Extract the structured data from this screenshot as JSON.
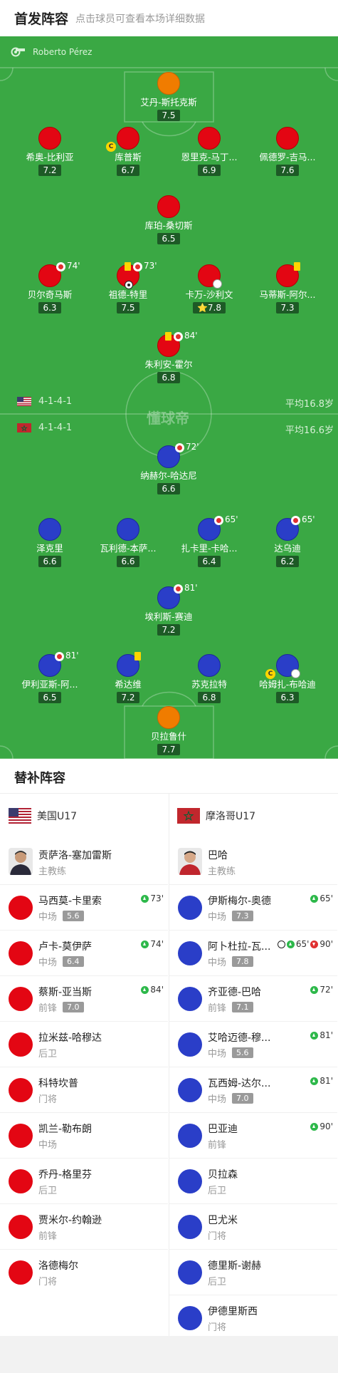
{
  "header": {
    "title": "首发阵容",
    "subtitle": "点击球员可查看本场详细数据"
  },
  "referee": {
    "icon": "whistle-icon",
    "name": "Roberto Pérez"
  },
  "home_lineup": {
    "formation": "4-1-4-1",
    "average_age": "平均16.8岁",
    "flag": "usa-flag-icon",
    "players": [
      {
        "name": "艾丹-斯托克斯",
        "rating": "7.5"
      },
      {
        "name": "希奥-比利亚",
        "rating": "7.2"
      },
      {
        "name": "库普斯",
        "rating": "6.7",
        "captain": "C"
      },
      {
        "name": "恩里克-马丁...",
        "rating": "6.9"
      },
      {
        "name": "佩德罗-吉马...",
        "rating": "7.6"
      },
      {
        "name": "库珀-桑切斯",
        "rating": "6.5"
      },
      {
        "name": "贝尔奇马斯",
        "rating": "6.3",
        "sub_off": "74'"
      },
      {
        "name": "祖德-特里",
        "rating": "7.5",
        "sub_off": "73'"
      },
      {
        "name": "卡万-沙利文",
        "rating": "7.8",
        "star": "⭐"
      },
      {
        "name": "马蒂斯-阿尔...",
        "rating": "7.3"
      },
      {
        "name": "朱利安-霍尔",
        "rating": "6.8",
        "sub_off": "84'"
      }
    ]
  },
  "away_lineup": {
    "formation": "4-1-4-1",
    "average_age": "平均16.6岁",
    "flag": "morocco-flag-icon",
    "players": [
      {
        "name": "纳赫尔-哈达尼",
        "rating": "6.6",
        "sub_off": "72'"
      },
      {
        "name": "泽克里",
        "rating": "6.6"
      },
      {
        "name": "瓦利德-本萨...",
        "rating": "6.6"
      },
      {
        "name": "扎卡里-卡哈...",
        "rating": "6.4",
        "sub_off": "65'"
      },
      {
        "name": "达乌迪",
        "rating": "6.2",
        "sub_off": "65'"
      },
      {
        "name": "埃利斯-赛迪",
        "rating": "7.2",
        "sub_off": "81'"
      },
      {
        "name": "伊利亚斯-阿...",
        "rating": "6.5",
        "sub_off": "81'"
      },
      {
        "name": "希达维",
        "rating": "7.2"
      },
      {
        "name": "苏克拉特",
        "rating": "6.8"
      },
      {
        "name": "哈姆扎-布哈迪",
        "rating": "6.3",
        "captain": "C"
      },
      {
        "name": "贝拉鲁什",
        "rating": "7.7"
      }
    ]
  },
  "pitch_logo": "懂球帝",
  "subs": {
    "title": "替补阵容",
    "home": {
      "team": "美国U17",
      "coach": {
        "name": "贡萨洛-塞加雷斯",
        "role": "主教练"
      },
      "players": [
        {
          "name": "马西莫-卡里索",
          "pos": "中场",
          "rating": "5.6",
          "event": "73'"
        },
        {
          "name": "卢卡-莫伊萨",
          "pos": "中场",
          "rating": "6.4",
          "event": "74'"
        },
        {
          "name": "蔡斯-亚当斯",
          "pos": "前锋",
          "rating": "7.0",
          "event": "84'"
        },
        {
          "name": "拉米兹-哈穆达",
          "pos": "后卫"
        },
        {
          "name": "科特坎普",
          "pos": "门将"
        },
        {
          "name": "凯兰-勒布朗",
          "pos": "中场"
        },
        {
          "name": "乔丹-格里芬",
          "pos": "后卫"
        },
        {
          "name": "贾米尔-约翰逊",
          "pos": "前锋"
        },
        {
          "name": "洛德梅尔",
          "pos": "门将"
        }
      ]
    },
    "away": {
      "team": "摩洛哥U17",
      "coach": {
        "name": "巴哈",
        "role": "主教练"
      },
      "players": [
        {
          "name": "伊斯梅尔-奥德",
          "pos": "中场",
          "rating": "7.3",
          "event": "65'"
        },
        {
          "name": "阿卜杜拉-瓦...",
          "pos": "中场",
          "rating": "7.8",
          "event": "65'",
          "event2": "90'"
        },
        {
          "name": "齐亚德-巴哈",
          "pos": "前锋",
          "rating": "7.1",
          "event": "72'"
        },
        {
          "name": "艾哈迈德-穆...",
          "pos": "中场",
          "rating": "5.6",
          "event": "81'"
        },
        {
          "name": "瓦西姆-达尔...",
          "pos": "中场",
          "rating": "7.0",
          "event": "81'"
        },
        {
          "name": "巴亚迪",
          "pos": "前锋",
          "event": "90'"
        },
        {
          "name": "贝拉森",
          "pos": "后卫"
        },
        {
          "name": "巴尤米",
          "pos": "门将"
        },
        {
          "name": "德里斯-谢赫",
          "pos": "后卫"
        },
        {
          "name": "伊德里斯西",
          "pos": "门将"
        }
      ]
    }
  },
  "colors": {
    "pitch": "#3aa844",
    "home_dot": "#e30613",
    "home_gk": "#f07c00",
    "away_dot": "#2a3ec8",
    "away_gk": "#f07c00",
    "rating_bg": "#1d5a26"
  }
}
